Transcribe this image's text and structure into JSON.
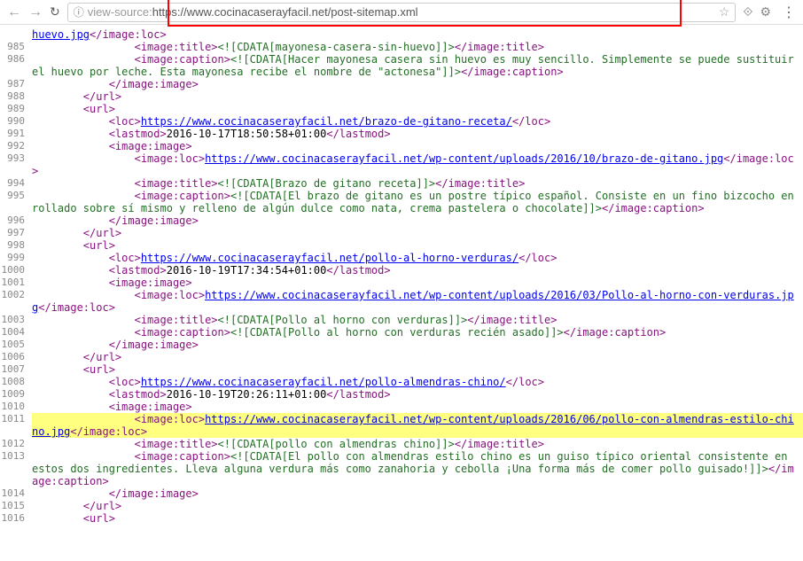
{
  "toolbar": {
    "url_prefix": "view-source:",
    "url": "https://www.cocinacaserayfacil.net/post-sitemap.xml"
  },
  "lines": [
    {
      "num": "",
      "indent": 0,
      "parts": [
        {
          "type": "url",
          "text": "huevo.jpg"
        },
        {
          "type": "tag",
          "text": "</image:loc>"
        }
      ]
    },
    {
      "num": "985",
      "indent": 4,
      "parts": [
        {
          "type": "tag",
          "text": "<image:title>"
        },
        {
          "type": "cdata",
          "text": "<![CDATA[mayonesa-casera-sin-huevo]]>"
        },
        {
          "type": "tag",
          "text": "</image:title>"
        }
      ]
    },
    {
      "num": "986",
      "indent": 4,
      "parts": [
        {
          "type": "tag",
          "text": "<image:caption>"
        },
        {
          "type": "cdata",
          "text": "<![CDATA[Hacer mayonesa casera sin huevo es muy sencillo. Simplemente se puede sustituir el huevo por leche. Esta mayonesa recibe el nombre de \"actonesa\"]]>"
        },
        {
          "type": "tag",
          "text": "</image:caption>"
        }
      ]
    },
    {
      "num": "987",
      "indent": 3,
      "parts": [
        {
          "type": "tag",
          "text": "</image:image>"
        }
      ]
    },
    {
      "num": "988",
      "indent": 2,
      "parts": [
        {
          "type": "tag",
          "text": "</url>"
        }
      ]
    },
    {
      "num": "989",
      "indent": 2,
      "parts": [
        {
          "type": "tag",
          "text": "<url>"
        }
      ]
    },
    {
      "num": "990",
      "indent": 3,
      "parts": [
        {
          "type": "tag",
          "text": "<loc>"
        },
        {
          "type": "url",
          "text": "https://www.cocinacaserayfacil.net/brazo-de-gitano-receta/"
        },
        {
          "type": "tag",
          "text": "</loc>"
        }
      ]
    },
    {
      "num": "991",
      "indent": 3,
      "parts": [
        {
          "type": "tag",
          "text": "<lastmod>"
        },
        {
          "type": "text",
          "text": "2016-10-17T18:50:58+01:00"
        },
        {
          "type": "tag",
          "text": "</lastmod>"
        }
      ]
    },
    {
      "num": "992",
      "indent": 3,
      "parts": [
        {
          "type": "tag",
          "text": "<image:image>"
        }
      ]
    },
    {
      "num": "993",
      "indent": 4,
      "parts": [
        {
          "type": "tag",
          "text": "<image:loc>"
        },
        {
          "type": "url",
          "text": "https://www.cocinacaserayfacil.net/wp-content/uploads/2016/10/brazo-de-gitano.jpg"
        },
        {
          "type": "tag",
          "text": "</image:loc>"
        }
      ]
    },
    {
      "num": "994",
      "indent": 4,
      "parts": [
        {
          "type": "tag",
          "text": "<image:title>"
        },
        {
          "type": "cdata",
          "text": "<![CDATA[Brazo de gitano receta]]>"
        },
        {
          "type": "tag",
          "text": "</image:title>"
        }
      ]
    },
    {
      "num": "995",
      "indent": 4,
      "parts": [
        {
          "type": "tag",
          "text": "<image:caption>"
        },
        {
          "type": "cdata",
          "text": "<![CDATA[El brazo de gitano es un postre típico español. Consiste en un fino bizcocho enrollado sobre sí mismo y relleno de algún dulce como nata, crema pastelera o chocolate]]>"
        },
        {
          "type": "tag",
          "text": "</image:caption>"
        }
      ]
    },
    {
      "num": "996",
      "indent": 3,
      "parts": [
        {
          "type": "tag",
          "text": "</image:image>"
        }
      ]
    },
    {
      "num": "997",
      "indent": 2,
      "parts": [
        {
          "type": "tag",
          "text": "</url>"
        }
      ]
    },
    {
      "num": "998",
      "indent": 2,
      "parts": [
        {
          "type": "tag",
          "text": "<url>"
        }
      ]
    },
    {
      "num": "999",
      "indent": 3,
      "parts": [
        {
          "type": "tag",
          "text": "<loc>"
        },
        {
          "type": "url",
          "text": "https://www.cocinacaserayfacil.net/pollo-al-horno-verduras/"
        },
        {
          "type": "tag",
          "text": "</loc>"
        }
      ]
    },
    {
      "num": "1000",
      "indent": 3,
      "parts": [
        {
          "type": "tag",
          "text": "<lastmod>"
        },
        {
          "type": "text",
          "text": "2016-10-19T17:34:54+01:00"
        },
        {
          "type": "tag",
          "text": "</lastmod>"
        }
      ]
    },
    {
      "num": "1001",
      "indent": 3,
      "parts": [
        {
          "type": "tag",
          "text": "<image:image>"
        }
      ]
    },
    {
      "num": "1002",
      "indent": 4,
      "parts": [
        {
          "type": "tag",
          "text": "<image:loc>"
        },
        {
          "type": "url",
          "text": "https://www.cocinacaserayfacil.net/wp-content/uploads/2016/03/Pollo-al-horno-con-verduras.jpg"
        },
        {
          "type": "tag",
          "text": "</image:loc>"
        }
      ]
    },
    {
      "num": "1003",
      "indent": 4,
      "parts": [
        {
          "type": "tag",
          "text": "<image:title>"
        },
        {
          "type": "cdata",
          "text": "<![CDATA[Pollo al horno con verduras]]>"
        },
        {
          "type": "tag",
          "text": "</image:title>"
        }
      ]
    },
    {
      "num": "1004",
      "indent": 4,
      "parts": [
        {
          "type": "tag",
          "text": "<image:caption>"
        },
        {
          "type": "cdata",
          "text": "<![CDATA[Pollo al horno con verduras recién asado]]>"
        },
        {
          "type": "tag",
          "text": "</image:caption>"
        }
      ]
    },
    {
      "num": "1005",
      "indent": 3,
      "parts": [
        {
          "type": "tag",
          "text": "</image:image>"
        }
      ]
    },
    {
      "num": "1006",
      "indent": 2,
      "parts": [
        {
          "type": "tag",
          "text": "</url>"
        }
      ]
    },
    {
      "num": "1007",
      "indent": 2,
      "parts": [
        {
          "type": "tag",
          "text": "<url>"
        }
      ]
    },
    {
      "num": "1008",
      "indent": 3,
      "parts": [
        {
          "type": "tag",
          "text": "<loc>"
        },
        {
          "type": "url",
          "text": "https://www.cocinacaserayfacil.net/pollo-almendras-chino/"
        },
        {
          "type": "tag",
          "text": "</loc>"
        }
      ]
    },
    {
      "num": "1009",
      "indent": 3,
      "parts": [
        {
          "type": "tag",
          "text": "<lastmod>"
        },
        {
          "type": "text",
          "text": "2016-10-19T20:26:11+01:00"
        },
        {
          "type": "tag",
          "text": "</lastmod>"
        }
      ]
    },
    {
      "num": "1010",
      "indent": 3,
      "parts": [
        {
          "type": "tag",
          "text": "<image:image>"
        }
      ]
    },
    {
      "num": "1011",
      "indent": 4,
      "highlighted": true,
      "parts": [
        {
          "type": "tag",
          "text": "<image:loc>"
        },
        {
          "type": "url",
          "text": "https://www.cocinacaserayfacil.net/wp-content/uploads/2016/06/pollo-con-almendras-estilo-chino.jpg"
        },
        {
          "type": "tag",
          "text": "</image:loc>"
        }
      ]
    },
    {
      "num": "1012",
      "indent": 4,
      "parts": [
        {
          "type": "tag",
          "text": "<image:title>"
        },
        {
          "type": "cdata",
          "text": "<![CDATA[pollo con almendras chino]]>"
        },
        {
          "type": "tag",
          "text": "</image:title>"
        }
      ]
    },
    {
      "num": "1013",
      "indent": 4,
      "parts": [
        {
          "type": "tag",
          "text": "<image:caption>"
        },
        {
          "type": "cdata",
          "text": "<![CDATA[El pollo con almendras estilo chino es un guiso típico oriental consistente en estos dos ingredientes. Lleva alguna verdura más como zanahoria y cebolla ¡Una forma más de comer pollo guisado!]]>"
        },
        {
          "type": "tag",
          "text": "</image:caption>"
        }
      ]
    },
    {
      "num": "1014",
      "indent": 3,
      "parts": [
        {
          "type": "tag",
          "text": "</image:image>"
        }
      ]
    },
    {
      "num": "1015",
      "indent": 2,
      "parts": [
        {
          "type": "tag",
          "text": "</url>"
        }
      ]
    },
    {
      "num": "1016",
      "indent": 2,
      "parts": [
        {
          "type": "tag",
          "text": "<url>"
        }
      ]
    }
  ]
}
